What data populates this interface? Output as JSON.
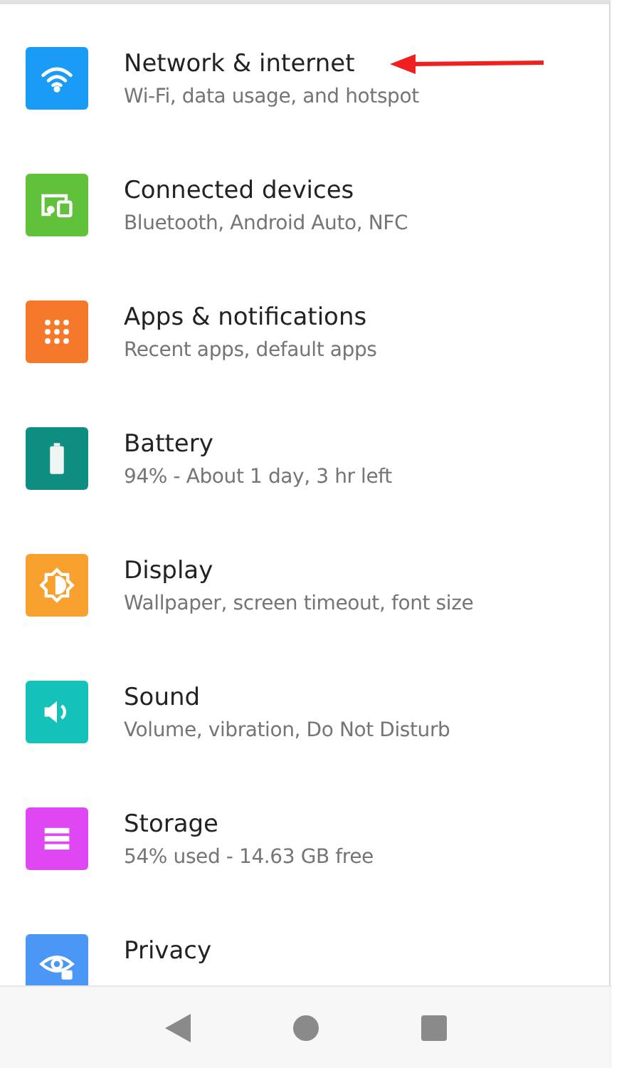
{
  "settings": [
    {
      "title": "Network & internet",
      "subtitle": "Wi-Fi, data usage, and hotspot",
      "color": "#1a9bf5"
    },
    {
      "title": "Connected devices",
      "subtitle": "Bluetooth, Android Auto, NFC",
      "color": "#5fc23a"
    },
    {
      "title": "Apps & notifications",
      "subtitle": "Recent apps, default apps",
      "color": "#f6782b"
    },
    {
      "title": "Battery",
      "subtitle": "94% - About 1 day, 3 hr left",
      "color": "#0e8e80"
    },
    {
      "title": "Display",
      "subtitle": "Wallpaper, screen timeout, font size",
      "color": "#f9a12e"
    },
    {
      "title": "Sound",
      "subtitle": "Volume, vibration, Do Not Disturb",
      "color": "#14c2ba"
    },
    {
      "title": "Storage",
      "subtitle": "54% used - 14.63 GB free",
      "color": "#df47f2"
    },
    {
      "title": "Privacy",
      "color": "#4b97f5"
    }
  ]
}
